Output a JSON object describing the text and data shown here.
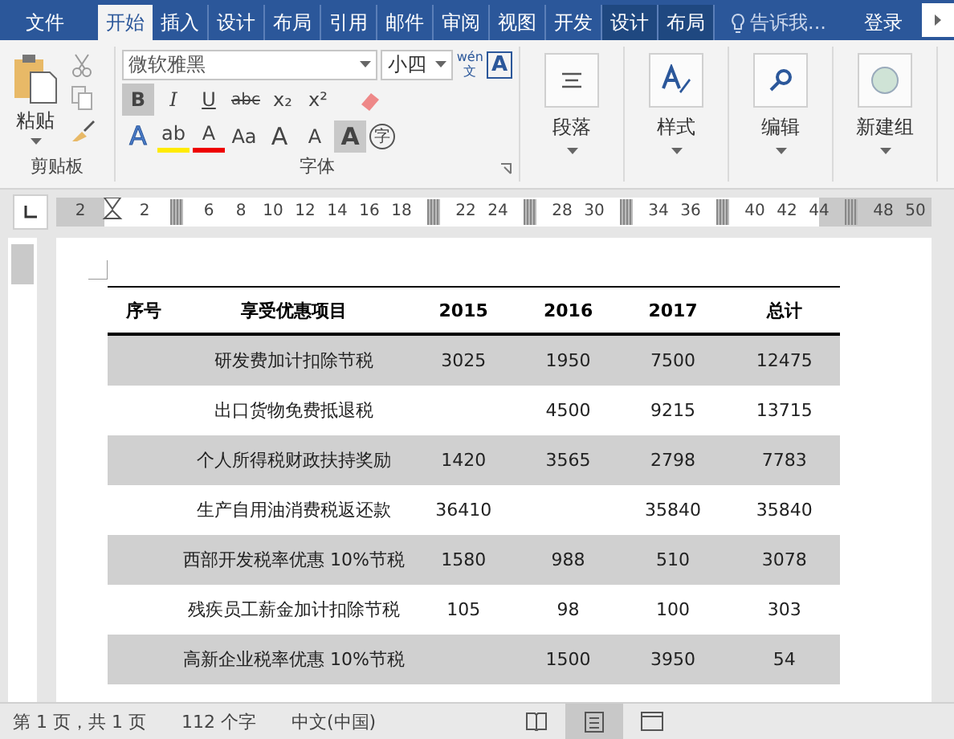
{
  "tabs": [
    {
      "label": "文件",
      "selected": false,
      "kind": "file"
    },
    {
      "label": "开始",
      "selected": true,
      "kind": "tab"
    },
    {
      "label": "插入",
      "selected": false,
      "kind": "tab"
    },
    {
      "label": "设计",
      "selected": false,
      "kind": "tab"
    },
    {
      "label": "布局",
      "selected": false,
      "kind": "tab"
    },
    {
      "label": "引用",
      "selected": false,
      "kind": "tab"
    },
    {
      "label": "邮件",
      "selected": false,
      "kind": "tab"
    },
    {
      "label": "审阅",
      "selected": false,
      "kind": "tab"
    },
    {
      "label": "视图",
      "selected": false,
      "kind": "tab"
    },
    {
      "label": "开发",
      "selected": false,
      "kind": "tab"
    },
    {
      "label": "设计",
      "selected": false,
      "kind": "context"
    },
    {
      "label": "布局",
      "selected": false,
      "kind": "context"
    }
  ],
  "tell_me": "告诉我...",
  "sign_in": "登录",
  "clipboard": {
    "paste": "粘贴",
    "group": "剪贴板"
  },
  "font": {
    "name": "微软雅黑",
    "size": "小四",
    "phonetic_top": "wén",
    "phonetic_bottom": "文",
    "border_char": "A",
    "group": "字体",
    "row1": [
      {
        "label": "B",
        "selected": true,
        "kind": "bold"
      },
      {
        "label": "I",
        "selected": false,
        "kind": "italic"
      },
      {
        "label": "U",
        "selected": false,
        "kind": "underline"
      },
      {
        "label": "abc",
        "selected": false,
        "kind": "strike"
      },
      {
        "label": "x₂",
        "selected": false,
        "kind": "plain"
      },
      {
        "label": "x²",
        "selected": false,
        "kind": "plain"
      }
    ],
    "row2": [
      {
        "label": "A",
        "kind": "effect"
      },
      {
        "label": "ab",
        "kind": "highlight"
      },
      {
        "label": "A",
        "kind": "color"
      },
      {
        "label": "Aa",
        "kind": "case"
      },
      {
        "label": "A",
        "kind": "grow"
      },
      {
        "label": "A",
        "kind": "shrink"
      },
      {
        "label": "A",
        "kind": "shade"
      },
      {
        "label": "字",
        "kind": "circle"
      }
    ]
  },
  "groups": [
    {
      "label": "段落",
      "kind": "paragraph"
    },
    {
      "label": "样式",
      "kind": "styles"
    },
    {
      "label": "编辑",
      "kind": "editing"
    },
    {
      "label": "新建组",
      "kind": "new"
    }
  ],
  "ruler": [
    {
      "kind": "label",
      "text": "2"
    },
    {
      "kind": "indent"
    },
    {
      "kind": "label",
      "text": "2"
    },
    {
      "kind": "block"
    },
    {
      "kind": "label",
      "text": "6"
    },
    {
      "kind": "label",
      "text": "8"
    },
    {
      "kind": "label",
      "text": "10"
    },
    {
      "kind": "label",
      "text": "12"
    },
    {
      "kind": "label",
      "text": "14"
    },
    {
      "kind": "label",
      "text": "16"
    },
    {
      "kind": "label",
      "text": "18"
    },
    {
      "kind": "block"
    },
    {
      "kind": "label",
      "text": "22"
    },
    {
      "kind": "label",
      "text": "24"
    },
    {
      "kind": "block"
    },
    {
      "kind": "label",
      "text": "28"
    },
    {
      "kind": "label",
      "text": "30"
    },
    {
      "kind": "block"
    },
    {
      "kind": "label",
      "text": "34"
    },
    {
      "kind": "label",
      "text": "36"
    },
    {
      "kind": "block"
    },
    {
      "kind": "label",
      "text": "40"
    },
    {
      "kind": "label",
      "text": "42"
    },
    {
      "kind": "label",
      "text": "44"
    },
    {
      "kind": "block"
    },
    {
      "kind": "label",
      "text": "48"
    },
    {
      "kind": "label",
      "text": "50"
    }
  ],
  "table": {
    "columns": [
      "序号",
      "享受优惠项目",
      "2015",
      "2016",
      "2017",
      "总计"
    ],
    "rows": [
      {
        "shaded": true,
        "cells": [
          "",
          "研发费加计扣除节税",
          "3025",
          "1950",
          "7500",
          "12475"
        ]
      },
      {
        "shaded": false,
        "cells": [
          "",
          "出口货物免费抵退税",
          "",
          "4500",
          "9215",
          "13715"
        ]
      },
      {
        "shaded": true,
        "cells": [
          "",
          "个人所得税财政扶持奖励",
          "1420",
          "3565",
          "2798",
          "7783"
        ]
      },
      {
        "shaded": false,
        "cells": [
          "",
          "生产自用油消费税返还款",
          "36410",
          "",
          "35840",
          "35840"
        ]
      },
      {
        "shaded": true,
        "cells": [
          "",
          "西部开发税率优惠 10%节税",
          "1580",
          "988",
          "510",
          "3078"
        ]
      },
      {
        "shaded": false,
        "cells": [
          "",
          "残疾员工薪金加计扣除节税",
          "105",
          "98",
          "100",
          "303"
        ]
      },
      {
        "shaded": true,
        "cells": [
          "",
          "高新企业税率优惠 10%节税",
          "",
          "1500",
          "3950",
          "54"
        ]
      }
    ]
  },
  "status": {
    "page": "第 1 页，共 1 页",
    "words": "112 个字",
    "language": "中文(中国)",
    "views": [
      {
        "kind": "read",
        "selected": false
      },
      {
        "kind": "print",
        "selected": true
      },
      {
        "kind": "web",
        "selected": false
      }
    ]
  }
}
